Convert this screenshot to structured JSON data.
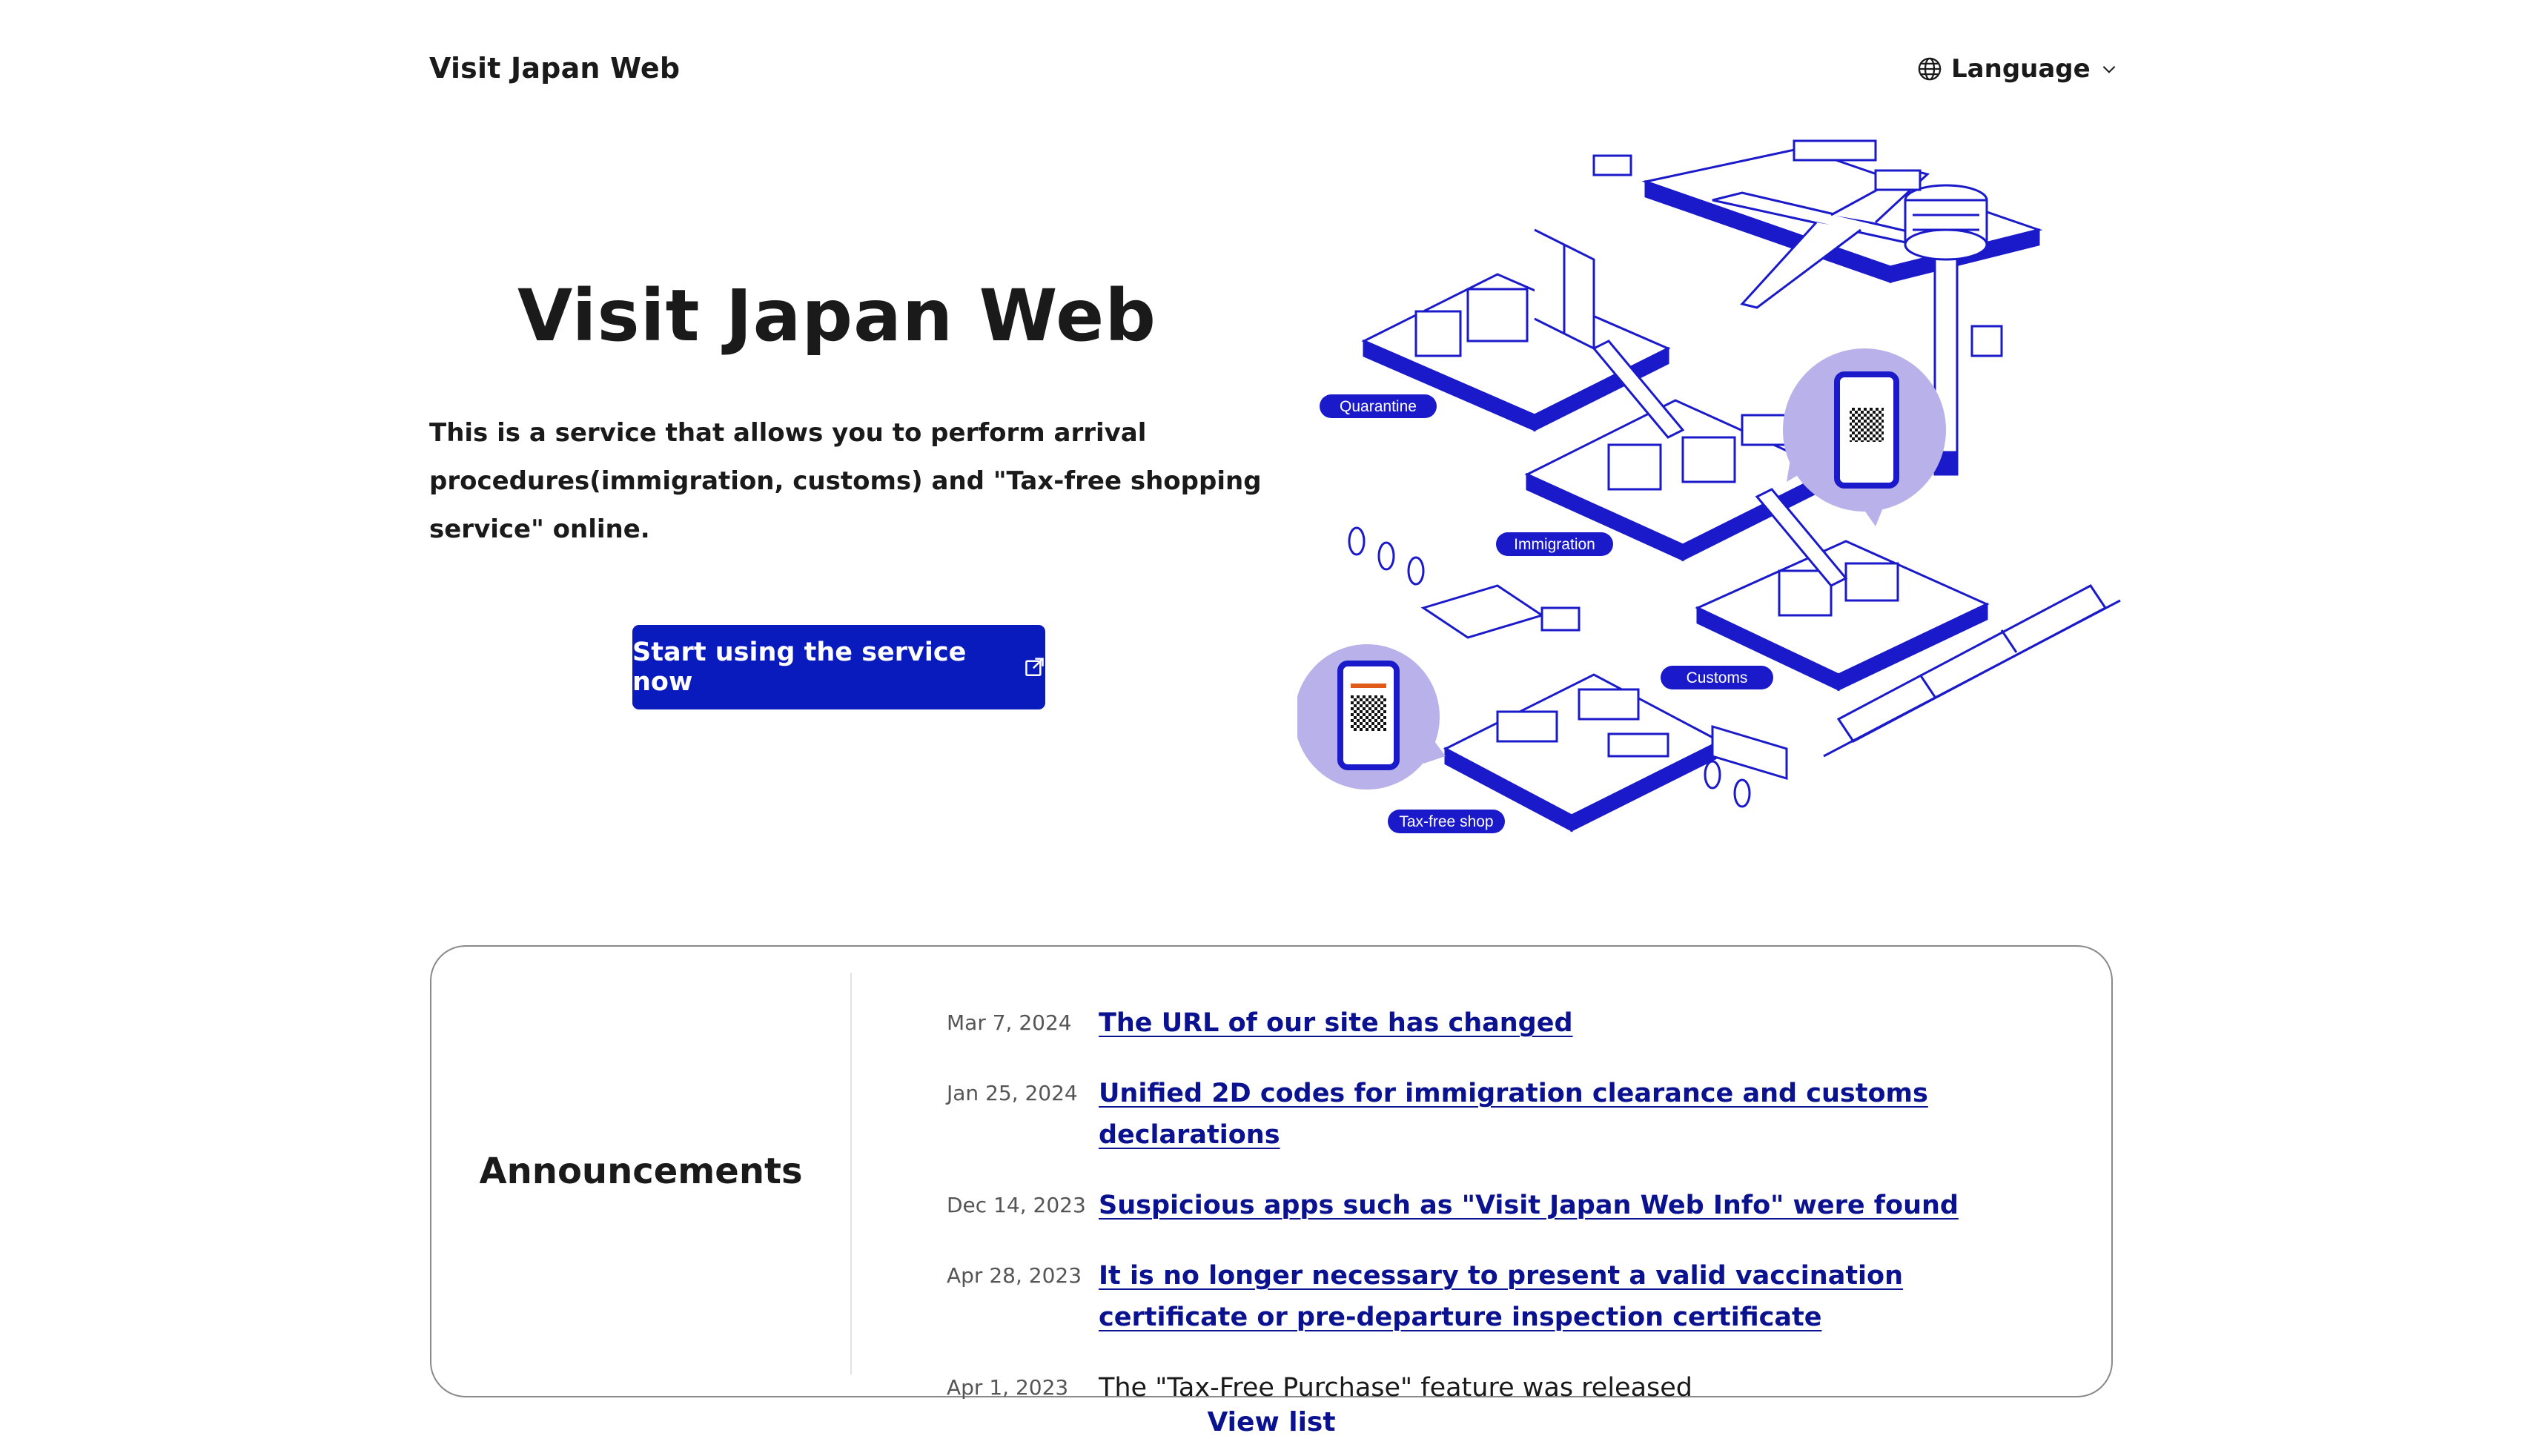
{
  "header": {
    "site_name": "Visit Japan Web",
    "language_label": "Language"
  },
  "hero": {
    "title": "Visit Japan Web",
    "description": "This is a service that allows you to perform arrival procedures(immigration, customs) and \"Tax-free shopping service\" online.",
    "cta_label": "Start using the service now"
  },
  "illustration": {
    "labels": {
      "quarantine": "Quarantine",
      "immigration": "Immigration",
      "customs": "Customs",
      "taxfree": "Tax-free shop"
    },
    "accent_color": "#1a1acb",
    "bubble_color": "#b9b1ea"
  },
  "announcements": {
    "heading": "Announcements",
    "items": [
      {
        "date": "Mar 7, 2024",
        "title": "The URL of our site has changed",
        "link": true
      },
      {
        "date": "Jan 25, 2024",
        "title": "Unified 2D codes for immigration clearance and customs declarations",
        "link": true
      },
      {
        "date": "Dec 14, 2023",
        "title": "Suspicious apps such as \"Visit Japan Web Info\" were found",
        "link": true
      },
      {
        "date": "Apr 28, 2023",
        "title": "It is no longer necessary to present a valid vaccination certificate or pre-departure inspection certificate",
        "link": true
      },
      {
        "date": "Apr 1, 2023",
        "title": "The \"Tax-Free Purchase\" feature was released",
        "link": false
      }
    ],
    "view_list_label": "View list"
  },
  "colors": {
    "primary": "#0a1bbd",
    "link": "#0a1290",
    "text": "#1a1a1a",
    "border": "#8a8a8a"
  }
}
